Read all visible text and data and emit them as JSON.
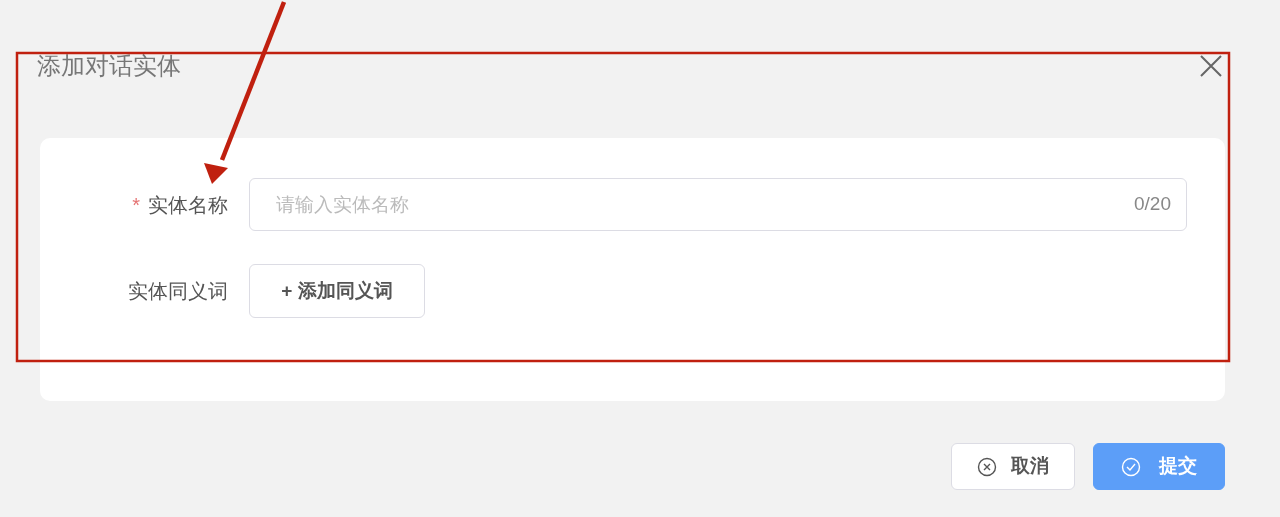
{
  "dialog": {
    "title": "添加对话实体",
    "close": true
  },
  "form": {
    "fields": [
      {
        "kind": "text",
        "label": "实体名称",
        "required_mark": "*",
        "placeholder": "请输入实体名称",
        "counter": "0/20"
      },
      {
        "kind": "button",
        "label": "实体同义词",
        "button": "+ 添加同义词"
      }
    ]
  },
  "buttons": [
    {
      "kind": "cancel",
      "label": "取消"
    },
    {
      "kind": "submit",
      "label": "提交"
    }
  ]
}
